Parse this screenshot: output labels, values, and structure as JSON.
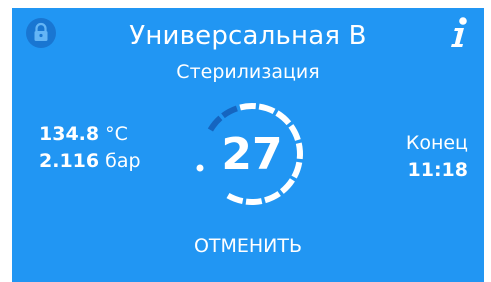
{
  "program": {
    "title": "Универсальная B",
    "phase": "Стерилизация"
  },
  "readings": {
    "temperature_value": "134.8",
    "temperature_unit": "°C",
    "pressure_value": "2.116",
    "pressure_unit": "бар"
  },
  "countdown": {
    "value": "27",
    "progress": 0.2
  },
  "end": {
    "label": "Конец",
    "time": "11:18"
  },
  "actions": {
    "cancel_label": "ОТМЕНИТЬ"
  },
  "icons": {
    "top_left": "lock-icon",
    "top_right": "info-icon"
  },
  "colors": {
    "background": "#2196f3",
    "text": "#ffffff",
    "progress_fill": "#1565c0",
    "lock_badge": "#1976d2"
  }
}
